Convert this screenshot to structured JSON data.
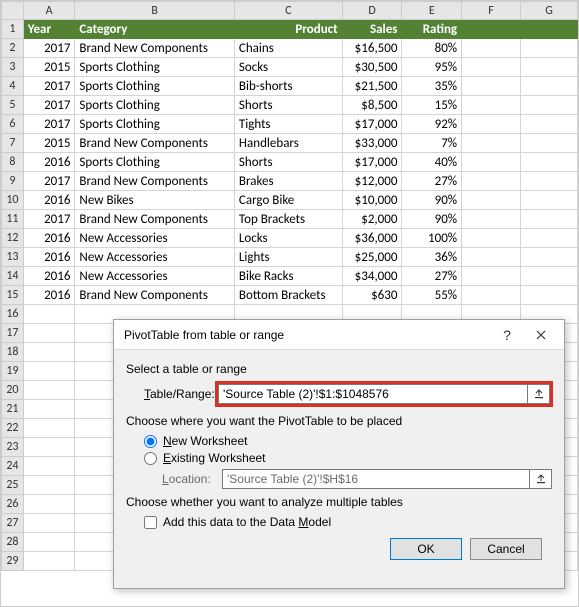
{
  "columns": [
    "A",
    "B",
    "C",
    "D",
    "E",
    "F",
    "G"
  ],
  "headers": {
    "A": "Year",
    "B": "Category",
    "C": "Product",
    "D": "Sales",
    "E": "Rating"
  },
  "rows": [
    {
      "n": 1
    },
    {
      "n": 2,
      "A": "2017",
      "B": "Brand New Components",
      "C": "Chains",
      "D": "$16,500",
      "E": "80%"
    },
    {
      "n": 3,
      "A": "2015",
      "B": "Sports Clothing",
      "C": "Socks",
      "D": "$30,500",
      "E": "95%"
    },
    {
      "n": 4,
      "A": "2017",
      "B": "Sports Clothing",
      "C": "Bib-shorts",
      "D": "$21,500",
      "E": "35%"
    },
    {
      "n": 5,
      "A": "2017",
      "B": "Sports Clothing",
      "C": "Shorts",
      "D": "$8,500",
      "E": "15%"
    },
    {
      "n": 6,
      "A": "2017",
      "B": "Sports Clothing",
      "C": "Tights",
      "D": "$17,000",
      "E": "92%"
    },
    {
      "n": 7,
      "A": "2015",
      "B": "Brand New Components",
      "C": "Handlebars",
      "D": "$33,000",
      "E": "7%"
    },
    {
      "n": 8,
      "A": "2016",
      "B": "Sports Clothing",
      "C": "Shorts",
      "D": "$17,000",
      "E": "40%"
    },
    {
      "n": 9,
      "A": "2017",
      "B": "Brand New Components",
      "C": "Brakes",
      "D": "$12,000",
      "E": "27%"
    },
    {
      "n": 10,
      "A": "2016",
      "B": "New Bikes",
      "C": "Cargo Bike",
      "D": "$10,000",
      "E": "90%"
    },
    {
      "n": 11,
      "A": "2017",
      "B": "Brand New Components",
      "C": "Top Brackets",
      "D": "$2,000",
      "E": "90%"
    },
    {
      "n": 12,
      "A": "2016",
      "B": "New Accessories",
      "C": "Locks",
      "D": "$36,000",
      "E": "100%"
    },
    {
      "n": 13,
      "A": "2016",
      "B": "New Accessories",
      "C": "Lights",
      "D": "$25,000",
      "E": "36%"
    },
    {
      "n": 14,
      "A": "2016",
      "B": "New Accessories",
      "C": "Bike Racks",
      "D": "$34,000",
      "E": "27%"
    },
    {
      "n": 15,
      "A": "2016",
      "B": "Brand New Components",
      "C": "Bottom Brackets",
      "D": "$630",
      "E": "55%"
    },
    {
      "n": 16
    },
    {
      "n": 17
    },
    {
      "n": 18
    },
    {
      "n": 19
    },
    {
      "n": 20
    },
    {
      "n": 21
    },
    {
      "n": 22
    },
    {
      "n": 23
    },
    {
      "n": 24
    },
    {
      "n": 25
    },
    {
      "n": 26
    },
    {
      "n": 27
    },
    {
      "n": 28
    },
    {
      "n": 29
    }
  ],
  "dialog": {
    "title": "PivotTable from table or range",
    "select_label": "Select a table or range",
    "table_range_label": "Table/Range:",
    "table_range_value": "'Source Table (2)'!$1:$1048576",
    "choose_place_label": "Choose where you want the PivotTable to be placed",
    "new_ws": "New Worksheet",
    "existing_ws": "Existing Worksheet",
    "location_label": "Location:",
    "location_value": "'Source Table (2)'!$H$16",
    "multi_label": "Choose whether you want to analyze multiple tables",
    "add_model": "Add this data to the Data Model",
    "ok": "OK",
    "cancel": "Cancel"
  },
  "colwidths": {
    "A": 52,
    "B": 160,
    "C": 108,
    "D": 60,
    "E": 60,
    "F": 60,
    "G": 58
  }
}
